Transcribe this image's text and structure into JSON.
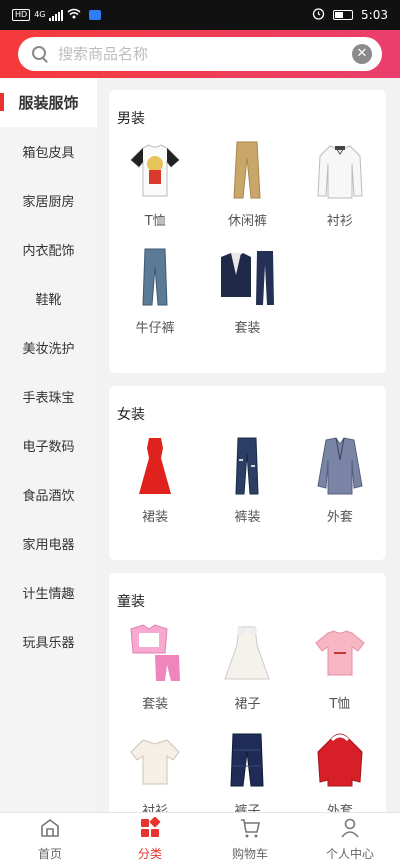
{
  "status_bar": {
    "hd": "HD",
    "network": "4G",
    "time": "5:03"
  },
  "search": {
    "placeholder": "搜索商品名称",
    "clear_icon": "clear-icon"
  },
  "sidebar": {
    "items": [
      {
        "label": "服装服饰",
        "active": true
      },
      {
        "label": "箱包皮具"
      },
      {
        "label": "家居厨房"
      },
      {
        "label": "内衣配饰"
      },
      {
        "label": "鞋靴"
      },
      {
        "label": "美妆洗护"
      },
      {
        "label": "手表珠宝"
      },
      {
        "label": "电子数码"
      },
      {
        "label": "食品酒饮"
      },
      {
        "label": "家用电器"
      },
      {
        "label": "计生情趣"
      },
      {
        "label": "玩具乐器"
      }
    ]
  },
  "sections": [
    {
      "title": "男装",
      "items": [
        {
          "label": "T恤",
          "icon": "tshirt-image"
        },
        {
          "label": "休闲裤",
          "icon": "khaki-pants-image"
        },
        {
          "label": "衬衫",
          "icon": "shirt-image"
        },
        {
          "label": "牛仔裤",
          "icon": "jeans-image"
        },
        {
          "label": "套装",
          "icon": "suit-image"
        }
      ]
    },
    {
      "title": "女装",
      "items": [
        {
          "label": "裙装",
          "icon": "red-dress-image"
        },
        {
          "label": "裤装",
          "icon": "ripped-jeans-image"
        },
        {
          "label": "外套",
          "icon": "blazer-image"
        }
      ]
    },
    {
      "title": "童装",
      "items": [
        {
          "label": "套装",
          "icon": "kids-pajama-image"
        },
        {
          "label": "裙子",
          "icon": "kids-dress-image"
        },
        {
          "label": "T恤",
          "icon": "kids-tshirt-image"
        },
        {
          "label": "衬衫",
          "icon": "kids-shirt-image"
        },
        {
          "label": "裤子",
          "icon": "kids-pants-image"
        },
        {
          "label": "外套",
          "icon": "kids-coat-image"
        }
      ]
    }
  ],
  "tabbar": {
    "items": [
      {
        "label": "首页",
        "icon": "home-icon"
      },
      {
        "label": "分类",
        "icon": "category-icon",
        "active": true
      },
      {
        "label": "购物车",
        "icon": "cart-icon"
      },
      {
        "label": "个人中心",
        "icon": "user-icon"
      }
    ]
  },
  "colors": {
    "accent": "#e8342f",
    "header_start": "#f43a3a",
    "header_end": "#ea3f6e"
  }
}
